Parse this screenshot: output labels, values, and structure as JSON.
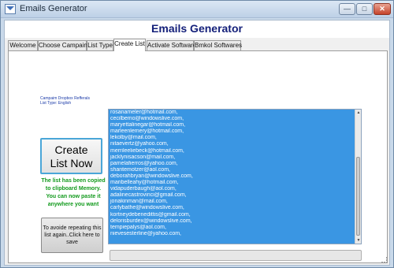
{
  "window": {
    "title": "Emails Generator",
    "min_glyph": "—",
    "max_glyph": "□",
    "close_glyph": "✕"
  },
  "app": {
    "heading": "Emails Generator"
  },
  "tabs": [
    {
      "label": "Welcome"
    },
    {
      "label": "Choose Campain"
    },
    {
      "label": "List Type"
    },
    {
      "label": "Create List"
    },
    {
      "label": "Activate Software"
    },
    {
      "label": "Bmkol Softwares"
    }
  ],
  "active_tab": "Create List",
  "panel": {
    "info_line1": "Campaim Dropbox Refferals",
    "info_line2": "List Type: English",
    "create_button_line1": "Create",
    "create_button_line2": "List Now",
    "copied_message": "The list has been copied to clipboard Memory. You can now paste it anywhere you want",
    "save_button_label": "To avoide repeating this list again..Click here to save"
  },
  "emails": [
    "rosanameler@hotmail.com,",
    "cecilbemo@windowslive.com,",
    "maryettalinegar@hotmail.com,",
    "marleenlemery@hotmail.com,",
    "lekolby@mail.com,",
    "nitaevertz@yahoo.com,",
    "merrileeliebeck@hotmail.com,",
    "jacklynisacson@mail.com,",
    "pamelafierros@yahoo.com,",
    "shantemotzer@aol.com,",
    "deborahbryan@windowslive.com,",
    "maribelleahy@hotmail.com,",
    "vidapuderbaugh@aol.com,",
    "adalinecastrovinci@gmail.com,",
    "jonakinman@mail.com,",
    "carlybathe@windowslive.com,",
    "kortneydebenedittis@gmail.com,",
    "delorisburdex@windowslive.com,",
    "tempiepalys@aol.com,",
    "nievesesterline@yahoo.com,"
  ],
  "scroll": {
    "up_glyph": "▲",
    "down_glyph": "▼"
  },
  "progress_fraction": 0.0,
  "colors": {
    "list_background": "#3a96e3",
    "copied_message": "#129a1d",
    "title": "#14207a"
  }
}
